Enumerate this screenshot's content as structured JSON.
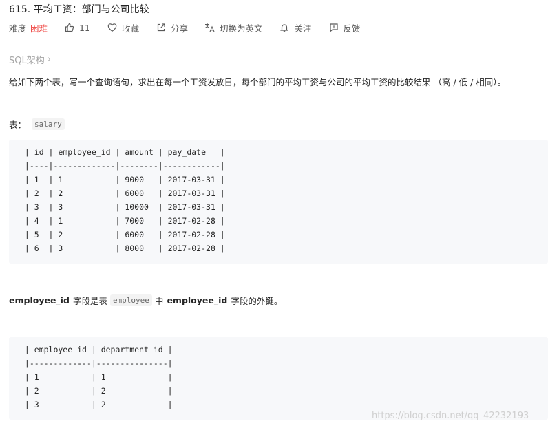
{
  "problem": {
    "title": "615. 平均工资：部门与公司比较",
    "difficulty_label": "难度",
    "difficulty_value": "困难",
    "likes": "11",
    "favorite_label": "收藏",
    "share_label": "分享",
    "translate_label": "切换为英文",
    "follow_label": "关注",
    "feedback_label": "反馈"
  },
  "breadcrumb": {
    "label": "SQL架构",
    "chevron": "›"
  },
  "description": "给如下两个表，写一个查询语句，求出在每一个工资发放日，每个部门的平均工资与公司的平均工资的比较结果 （高 / 低 / 相同）。",
  "salary_section": {
    "prefix": "表：",
    "table_name": "salary",
    "code": " | id | employee_id | amount | pay_date   |\n |----|-------------|--------|------------|\n | 1  | 1           | 9000   | 2017-03-31 |\n | 2  | 2           | 6000   | 2017-03-31 |\n | 3  | 3           | 10000  | 2017-03-31 |\n | 4  | 1           | 7000   | 2017-02-28 |\n | 5  | 2           | 6000   | 2017-02-28 |\n | 6  | 3           | 8000   | 2017-02-28 |"
  },
  "fk_note": {
    "field1": "employee_id",
    "text1": "字段是表",
    "table": "employee",
    "text2": "中",
    "field2": "employee_id",
    "text3": "字段的外键。"
  },
  "employee_section": {
    "code": " | employee_id | department_id |\n |-------------|---------------|\n | 1           | 1             |\n | 2           | 2             |\n | 3           | 2             |"
  },
  "watermark": "https://blog.csdn.net/qq_42232193",
  "colors": {
    "hard": "#ef4743",
    "muted": "#a6a6a6",
    "code_bg": "#f7f8fa"
  }
}
